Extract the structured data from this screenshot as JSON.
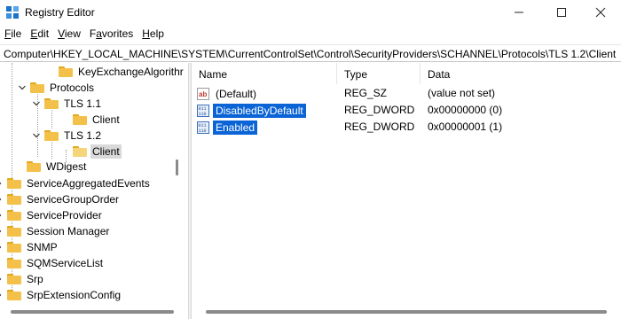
{
  "window": {
    "title": "Registry Editor",
    "minimize_icon": "minimize-icon",
    "maximize_icon": "maximize-icon",
    "close_icon": "close-icon"
  },
  "menu": [
    {
      "accel": "F",
      "rest": "ile"
    },
    {
      "accel": "E",
      "rest": "dit"
    },
    {
      "accel": "V",
      "rest": "iew"
    },
    {
      "accel": "",
      "rest": "Favorites",
      "accel_index": 1
    },
    {
      "accel": "H",
      "rest": "elp"
    }
  ],
  "menu_labels": {
    "favorites_pre": "F",
    "favorites_accel": "a",
    "favorites_post": "vorites"
  },
  "address_path": "Computer\\HKEY_LOCAL_MACHINE\\SYSTEM\\CurrentControlSet\\Control\\SecurityProviders\\SCHANNEL\\Protocols\\TLS 1.2\\Client",
  "tree": [
    {
      "label": "KeyExchangeAlgorithr",
      "expander": "none",
      "open": false
    },
    {
      "label": "Protocols",
      "expander": "expanded",
      "open": false
    },
    {
      "label": "TLS 1.1",
      "expander": "expanded",
      "open": false
    },
    {
      "label": "Client",
      "expander": "none",
      "open": false
    },
    {
      "label": "TLS 1.2",
      "expander": "expanded",
      "open": false
    },
    {
      "label": "Client",
      "expander": "none",
      "open": true,
      "selected": true
    },
    {
      "label": "WDigest",
      "expander": "none",
      "open": false
    },
    {
      "label": "ServiceAggregatedEvents",
      "expander": "collapsed",
      "open": false
    },
    {
      "label": "ServiceGroupOrder",
      "expander": "collapsed",
      "open": false
    },
    {
      "label": "ServiceProvider",
      "expander": "collapsed",
      "open": false
    },
    {
      "label": "Session Manager",
      "expander": "collapsed",
      "open": false
    },
    {
      "label": "SNMP",
      "expander": "collapsed",
      "open": false
    },
    {
      "label": "SQMServiceList",
      "expander": "none",
      "open": false
    },
    {
      "label": "Srp",
      "expander": "collapsed",
      "open": false
    },
    {
      "label": "SrpExtensionConfig",
      "expander": "collapsed",
      "open": false
    }
  ],
  "columns": {
    "name": "Name",
    "type": "Type",
    "data": "Data"
  },
  "values": [
    {
      "name": "(Default)",
      "type": "REG_SZ",
      "data": "(value not set)",
      "icon": "string-value-icon",
      "selected": false
    },
    {
      "name": "DisabledByDefault",
      "type": "REG_DWORD",
      "data": "0x00000000 (0)",
      "icon": "binary-value-icon",
      "selected": true
    },
    {
      "name": "Enabled",
      "type": "REG_DWORD",
      "data": "0x00000001 (1)",
      "icon": "binary-value-icon",
      "selected": true
    }
  ],
  "colors": {
    "selection": "#0a64d6",
    "folder": "#f3c14a",
    "tree_selection": "#d9d9d9"
  }
}
